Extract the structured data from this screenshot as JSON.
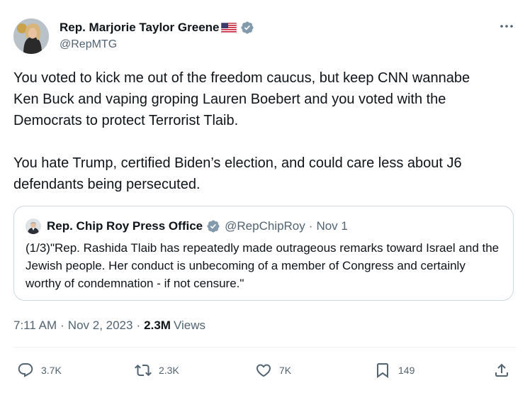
{
  "tweet": {
    "author_name": "Rep. Marjorie Taylor Greene",
    "author_handle": "@RepMTG",
    "text": "You voted to kick me out of the freedom caucus, but keep CNN wannabe\nKen Buck and vaping groping Lauren Boebert and you voted with the\nDemocrats to protect Terrorist Tlaib.\n\nYou hate Trump, certified Biden’s election, and could care less about J6\ndefendants being persecuted.",
    "time": "7:11 AM",
    "date": "Nov 2, 2023",
    "separator": "·",
    "views_count": "2.3M",
    "views_label": "Views"
  },
  "quote": {
    "author_name": "Rep. Chip Roy Press Office",
    "author_handle": "@RepChipRoy",
    "date": "Nov 1",
    "text": "(1/3)\"Rep. Rashida Tlaib has repeatedly made outrageous remarks toward Israel and the Jewish people. Her conduct is unbecoming of a member of Congress and certainly worthy of condemnation - if not censure.\""
  },
  "actions": {
    "replies": "3.7K",
    "reposts": "2.3K",
    "likes": "7K",
    "bookmarks": "149"
  },
  "icons": {
    "verified": "verified-badge-icon",
    "flag": "us-flag-icon",
    "more": "more-horizontal-icon",
    "reply": "reply-icon",
    "repost": "repost-icon",
    "like": "heart-icon",
    "bookmark": "bookmark-icon",
    "share": "share-icon"
  },
  "colors": {
    "verified": "#829aab",
    "text": "#0f1419",
    "secondary": "#536471",
    "border": "#cfd9de"
  }
}
